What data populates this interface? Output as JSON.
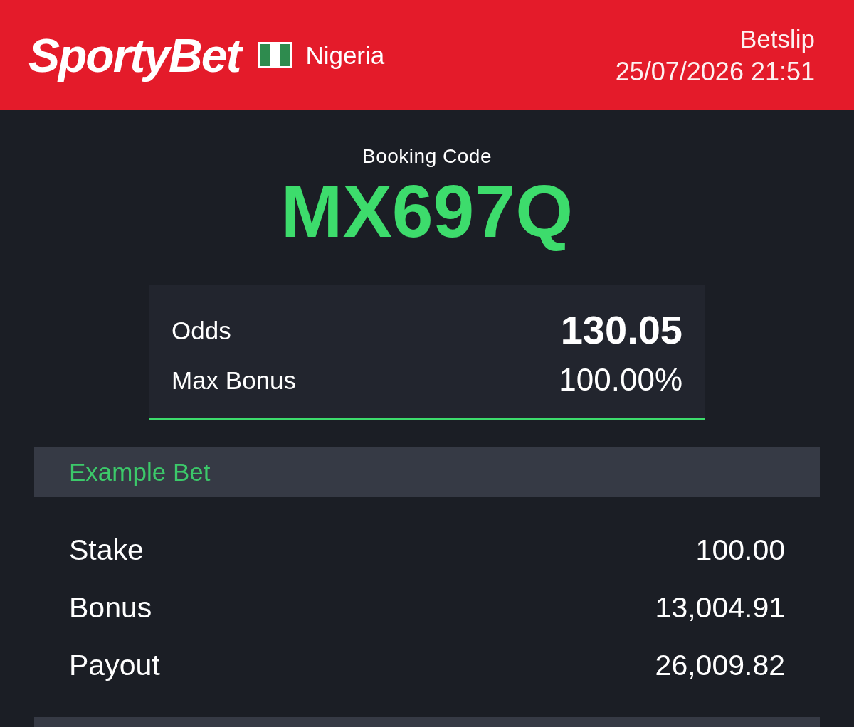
{
  "header": {
    "logo": "SportyBet",
    "country": "Nigeria",
    "title": "Betslip",
    "datetime": "25/07/2026 21:51"
  },
  "booking": {
    "label": "Booking Code",
    "code": "MX697Q"
  },
  "summary": [
    {
      "kind": "primary",
      "label": "Odds",
      "value": "130.05"
    },
    {
      "kind": "secondary",
      "label": "Max Bonus",
      "value": "100.00%"
    }
  ],
  "example": {
    "title": "Example Bet",
    "rows": [
      {
        "label": "Stake",
        "value": "100.00"
      },
      {
        "label": "Bonus",
        "value": "13,004.91"
      },
      {
        "label": "Payout",
        "value": "26,009.82"
      }
    ]
  }
}
